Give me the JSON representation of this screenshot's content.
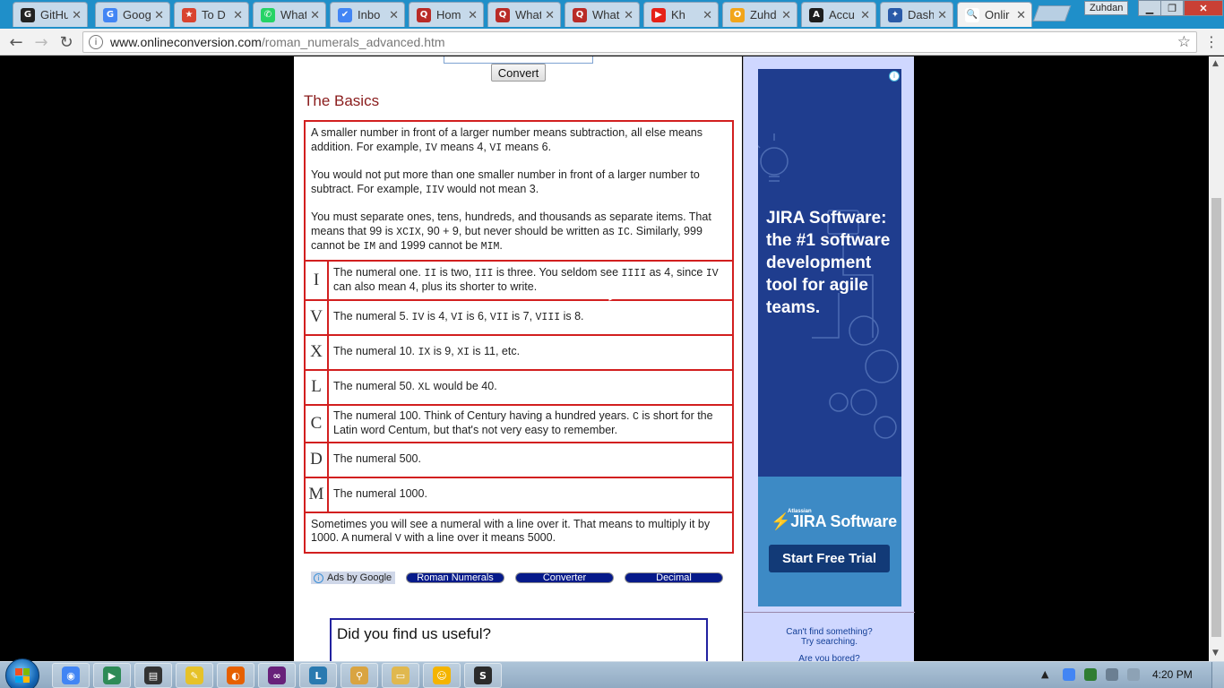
{
  "browser": {
    "tabs": [
      {
        "title": "GitHu",
        "icon": "github-icon",
        "color": "#222222",
        "glyph": "G"
      },
      {
        "title": "Goog",
        "icon": "google-icon",
        "color": "#4285f4",
        "glyph": "G"
      },
      {
        "title": "To D",
        "icon": "todo-icon",
        "color": "#d9432f",
        "glyph": "★"
      },
      {
        "title": "What",
        "icon": "whatsapp-icon",
        "color": "#25d366",
        "glyph": "✆"
      },
      {
        "title": "Inbo",
        "icon": "inbox-icon",
        "color": "#4285f4",
        "glyph": "✔"
      },
      {
        "title": "Hom",
        "icon": "quora-icon",
        "color": "#b92b27",
        "glyph": "Q"
      },
      {
        "title": "What",
        "icon": "quora-icon",
        "color": "#b92b27",
        "glyph": "Q"
      },
      {
        "title": "What",
        "icon": "quora-icon",
        "color": "#b92b27",
        "glyph": "Q"
      },
      {
        "title": "Kh",
        "icon": "youtube-icon",
        "color": "#e62117",
        "glyph": "▶"
      },
      {
        "title": "Zuhd",
        "icon": "orange-o-icon",
        "color": "#f2a51a",
        "glyph": "O"
      },
      {
        "title": "Accu",
        "icon": "accu-icon",
        "color": "#1d1d1d",
        "glyph": "A"
      },
      {
        "title": "Dash",
        "icon": "dash-icon",
        "color": "#2a5aa8",
        "glyph": "✦"
      },
      {
        "title": "Onlir",
        "icon": "onlineconversion-icon",
        "color": "#ffffff",
        "glyph": "🔍"
      }
    ],
    "user_name": "Zuhdan",
    "url_host": "www.onlineconversion.com",
    "url_path": "/roman_numerals_advanced.htm"
  },
  "page": {
    "convert_label": "Convert",
    "basics_heading": "The Basics",
    "intro": [
      [
        "A smaller number in front of a larger number means subtraction, all else means addition. For example, ",
        "IV",
        " means 4, ",
        "VI",
        " means 6."
      ],
      [
        "You would not put more than one smaller number in front of a larger number to subtract. For example, ",
        "IIV",
        " would not mean 3."
      ],
      [
        "You must separate ones, tens, hundreds, and thousands as separate items. That means that 99 is ",
        "XCIX",
        ", 90 + 9, but never should be written as ",
        "IC",
        ". Similarly, 999 cannot be ",
        "IM",
        " and 1999 cannot be ",
        "MIM",
        "."
      ]
    ],
    "numerals": [
      {
        "symbol": "I",
        "parts": [
          "The numeral one. ",
          "II",
          " is two, ",
          "III",
          " is three. You seldom see ",
          "IIII",
          " as 4, since ",
          "IV",
          " can also mean 4, plus its shorter to write."
        ]
      },
      {
        "symbol": "V",
        "parts": [
          "The numeral 5. ",
          "IV",
          " is 4, ",
          "VI",
          " is 6, ",
          "VII",
          " is 7, ",
          "VIII",
          " is 8."
        ]
      },
      {
        "symbol": "X",
        "parts": [
          "The numeral 10. ",
          "IX",
          " is 9, ",
          "XI",
          " is 11, etc."
        ]
      },
      {
        "symbol": "L",
        "parts": [
          "The numeral 50. ",
          "XL",
          " would be 40."
        ]
      },
      {
        "symbol": "C",
        "parts": [
          "The numeral 100. Think of Century having a hundred years. ",
          "C",
          " is short for the Latin word Centum, but that's not very easy to remember."
        ]
      },
      {
        "symbol": "D",
        "parts": [
          "The numeral 500."
        ]
      },
      {
        "symbol": "M",
        "parts": [
          "The numeral 1000."
        ]
      }
    ],
    "outro": [
      "Sometimes you will see a numeral with a line over it. That means to multiply it by 1000. A numeral ",
      "V",
      " with a line over it means 5000."
    ],
    "ads_label": "Ads by Google",
    "ad_links": [
      "Roman Numerals",
      "Converter",
      "Decimal"
    ],
    "useful_heading": "Did you find us useful?"
  },
  "side_ad": {
    "headline": "JIRA Software: the #1 software development tool for agile teams.",
    "brand_small": "Atlassian",
    "brand": "JIRA Software",
    "cta": "Start Free Trial",
    "bg_color": "#1f3d8e",
    "lower_color": "#3d8ac5"
  },
  "side": {
    "cant_find_1": "Can't find something?",
    "cant_find_2": "Try searching.",
    "bored": "Are you bored?"
  },
  "taskbar": {
    "apps": [
      "chrome-icon",
      "media-center-icon",
      "terminal-icon",
      "sticky-notes-icon",
      "firefox-icon",
      "visual-studio-icon",
      "lync-icon",
      "magnifier-icon",
      "file-explorer-icon",
      "smiley-icon",
      "sublime-icon"
    ],
    "clock": "4:20 PM"
  }
}
